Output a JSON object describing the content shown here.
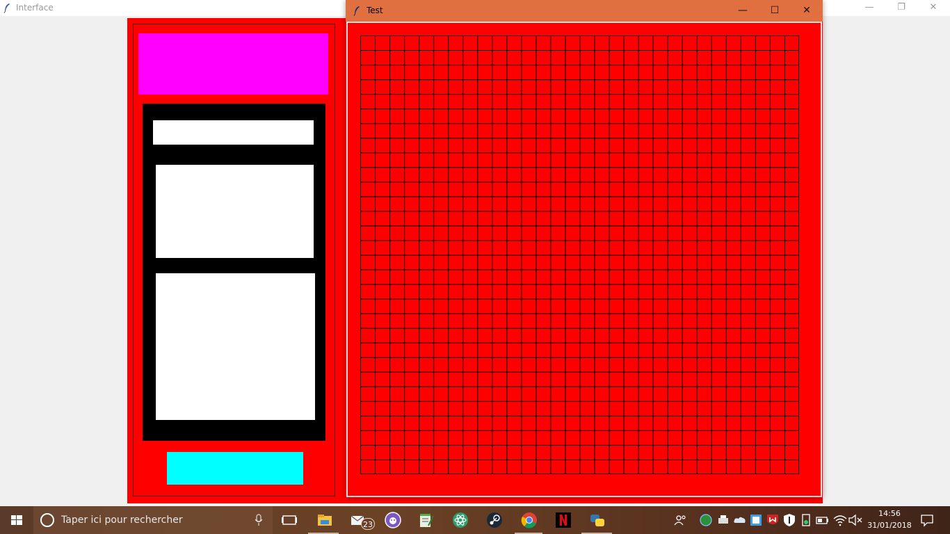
{
  "window_back": {
    "title": "Interface",
    "minimize": "—",
    "restore": "❐",
    "close": "✕"
  },
  "window_front": {
    "title": "Test",
    "minimize": "—",
    "maximize": "☐",
    "close": "✕"
  },
  "grid": {
    "rows": 30,
    "cols": 30,
    "cell_color": "#ff0000",
    "line_color": "#000000"
  },
  "colors": {
    "panel_red": "#ff0000",
    "magenta": "#ff00ff",
    "black": "#000000",
    "white": "#ffffff",
    "cyan": "#00ffff",
    "titlebar_active": "#e07040"
  },
  "taskbar": {
    "search_placeholder": "Taper ici pour rechercher",
    "mail_badge": "23",
    "time": "14:56",
    "date": "31/01/2018",
    "icons": [
      "task-view-icon",
      "file-explorer-icon",
      "mail-icon",
      "purple-app-icon",
      "notepad-icon",
      "atom-icon",
      "steam-icon",
      "chrome-icon",
      "netflix-icon",
      "python-icon"
    ],
    "tray_icons": [
      "people-icon",
      "network-globe-icon",
      "printer-icon",
      "cloud-icon",
      "app-tray-icon",
      "mcafee-icon",
      "shield-icon",
      "usb-icon",
      "battery-icon",
      "wifi-icon",
      "volume-muted-icon",
      "notification-icon"
    ]
  }
}
